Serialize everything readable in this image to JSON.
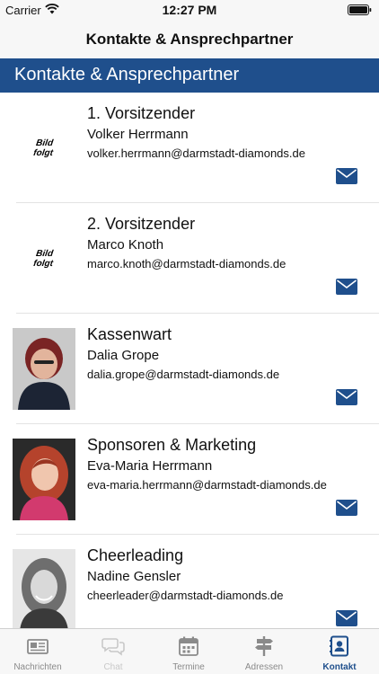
{
  "status_bar": {
    "carrier": "Carrier",
    "time": "12:27 PM"
  },
  "nav": {
    "title": "Kontakte & Ansprechpartner"
  },
  "section_header": "Kontakte & Ansprechpartner",
  "placeholder_text": "Bild\nfolgt",
  "contacts": [
    {
      "role": "1. Vorsitzender",
      "name": "Volker Herrmann",
      "email": "volker.herrmann@darmstadt-diamonds.de",
      "photo": "placeholder"
    },
    {
      "role": "2. Vorsitzender",
      "name": "Marco Knoth",
      "email": "marco.knoth@darmstadt-diamonds.de",
      "photo": "placeholder"
    },
    {
      "role": "Kassenwart",
      "name": "Dalia Grope",
      "email": "dalia.grope@darmstadt-diamonds.de",
      "photo": "portrait"
    },
    {
      "role": "Sponsoren & Marketing",
      "name": "Eva-Maria Herrmann",
      "email": "eva-maria.herrmann@darmstadt-diamonds.de",
      "photo": "portrait"
    },
    {
      "role": "Cheerleading",
      "name": "Nadine Gensler",
      "email": "cheerleader@darmstadt-diamonds.de",
      "photo": "portrait"
    }
  ],
  "tabs": [
    {
      "label": "Nachrichten",
      "icon": "newspaper-icon",
      "state": "normal"
    },
    {
      "label": "Chat",
      "icon": "chat-bubbles-icon",
      "state": "disabled"
    },
    {
      "label": "Termine",
      "icon": "calendar-icon",
      "state": "normal"
    },
    {
      "label": "Adressen",
      "icon": "signpost-icon",
      "state": "normal"
    },
    {
      "label": "Kontakt",
      "icon": "contact-book-icon",
      "state": "active"
    }
  ],
  "colors": {
    "accent": "#1f4f8c",
    "bar_background": "#f7f7f7",
    "inactive_tab": "#8a8a8a",
    "disabled_tab": "#c8c8c8"
  }
}
